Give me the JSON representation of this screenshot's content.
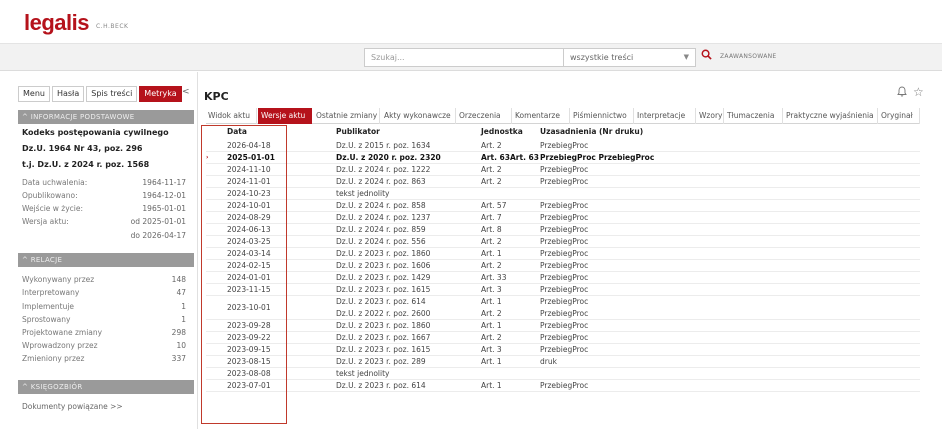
{
  "brand": {
    "logo": "legalis",
    "logo_sub": "C.H.BECK"
  },
  "search": {
    "placeholder": "Szukaj...",
    "scope": "wszystkie treści",
    "advanced": "ZAAWANSOWANE"
  },
  "sidebar": {
    "tabs": [
      "Menu",
      "Hasła",
      "Spis treści",
      "Metryka"
    ],
    "active_tab": "Metryka",
    "basic_info": {
      "heading": "INFORMACJE PODSTAWOWE",
      "title": "Kodeks postępowania cywilnego",
      "dzu": "Dz.U. 1964 Nr 43, poz. 296",
      "tj": "t.j. Dz.U. z 2024 r. poz. 1568",
      "fields": [
        {
          "label": "Data uchwalenia:",
          "value": "1964-11-17"
        },
        {
          "label": "Opublikowano:",
          "value": "1964-12-01"
        },
        {
          "label": "Wejście w życie:",
          "value": "1965-01-01"
        },
        {
          "label": "Wersja aktu:",
          "value": "od 2025-01-01"
        },
        {
          "label": "",
          "value": "do 2026-04-17"
        }
      ]
    },
    "relations": {
      "heading": "RELACJE",
      "items": [
        {
          "label": "Wykonywany przez",
          "value": "148"
        },
        {
          "label": "Interpretowany",
          "value": "47"
        },
        {
          "label": "Implementuje",
          "value": "1"
        },
        {
          "label": "Sprostowany",
          "value": "1"
        },
        {
          "label": "Projektowane zmiany",
          "value": "298"
        },
        {
          "label": "Wprowadzony przez",
          "value": "10"
        },
        {
          "label": "Zmieniony przez",
          "value": "337"
        }
      ]
    },
    "library": {
      "heading": "KSIĘGOZBIÓR",
      "link": "Dokumenty powiązane >>"
    }
  },
  "main": {
    "title": "KPC",
    "tabs": [
      "Widok aktu",
      "Wersje aktu",
      "Ostatnie zmiany",
      "Akty wykonawcze",
      "Orzeczenia",
      "Komentarze",
      "Piśmiennictwo",
      "Interpretacje",
      "Wzory",
      "Tłumaczenia",
      "Praktyczne wyjaśnienia",
      "Oryginał"
    ],
    "active_tab": "Wersje aktu",
    "columns": [
      "Data",
      "Publikator",
      "Jednostka",
      "Uzasadnienia (Nr druku)"
    ],
    "rows": [
      {
        "date": "2026-04-18",
        "pub": [
          "Dz.U. z 2015 r. poz. 1634"
        ],
        "unit": [
          "Art. 2"
        ],
        "just": [
          "PrzebiegProc"
        ]
      },
      {
        "date": "2025-01-01",
        "pub": [
          "Dz.U. z 2020 r. poz. 2320"
        ],
        "unit": [
          "Art. 63Art. 63"
        ],
        "just": [
          "PrzebiegProc PrzebiegProc"
        ],
        "current": true
      },
      {
        "date": "2024-11-10",
        "pub": [
          "Dz.U. z 2024 r. poz. 1222"
        ],
        "unit": [
          "Art. 2"
        ],
        "just": [
          "PrzebiegProc"
        ]
      },
      {
        "date": "2024-11-01",
        "pub": [
          "Dz.U. z 2024 r. poz. 863"
        ],
        "unit": [
          "Art. 2"
        ],
        "just": [
          "PrzebiegProc"
        ]
      },
      {
        "date": "2024-10-23",
        "pub": [
          "tekst jednolity"
        ],
        "unit": [
          ""
        ],
        "just": [
          ""
        ]
      },
      {
        "date": "2024-10-01",
        "pub": [
          "Dz.U. z 2024 r. poz. 858"
        ],
        "unit": [
          "Art. 57"
        ],
        "just": [
          "PrzebiegProc"
        ]
      },
      {
        "date": "2024-08-29",
        "pub": [
          "Dz.U. z 2024 r. poz. 1237"
        ],
        "unit": [
          "Art. 7"
        ],
        "just": [
          "PrzebiegProc"
        ]
      },
      {
        "date": "2024-06-13",
        "pub": [
          "Dz.U. z 2024 r. poz. 859"
        ],
        "unit": [
          "Art. 8"
        ],
        "just": [
          "PrzebiegProc"
        ]
      },
      {
        "date": "2024-03-25",
        "pub": [
          "Dz.U. z 2024 r. poz. 556"
        ],
        "unit": [
          "Art. 2"
        ],
        "just": [
          "PrzebiegProc"
        ]
      },
      {
        "date": "2024-03-14",
        "pub": [
          "Dz.U. z 2023 r. poz. 1860"
        ],
        "unit": [
          "Art. 1"
        ],
        "just": [
          "PrzebiegProc"
        ]
      },
      {
        "date": "2024-02-15",
        "pub": [
          "Dz.U. z 2023 r. poz. 1606"
        ],
        "unit": [
          "Art. 2"
        ],
        "just": [
          "PrzebiegProc"
        ]
      },
      {
        "date": "2024-01-01",
        "pub": [
          "Dz.U. z 2023 r. poz. 1429"
        ],
        "unit": [
          "Art. 33"
        ],
        "just": [
          "PrzebiegProc"
        ]
      },
      {
        "date": "2023-11-15",
        "pub": [
          "Dz.U. z 2023 r. poz. 1615"
        ],
        "unit": [
          "Art. 3"
        ],
        "just": [
          "PrzebiegProc"
        ]
      },
      {
        "date": "2023-10-01",
        "pub": [
          "Dz.U. z 2023 r. poz. 614",
          "Dz.U. z 2022 r. poz. 2600"
        ],
        "unit": [
          "Art. 1",
          "Art. 2"
        ],
        "just": [
          "PrzebiegProc",
          "PrzebiegProc"
        ]
      },
      {
        "date": "2023-09-28",
        "pub": [
          "Dz.U. z 2023 r. poz. 1860"
        ],
        "unit": [
          "Art. 1"
        ],
        "just": [
          "PrzebiegProc"
        ]
      },
      {
        "date": "2023-09-22",
        "pub": [
          "Dz.U. z 2023 r. poz. 1667"
        ],
        "unit": [
          "Art. 2"
        ],
        "just": [
          "PrzebiegProc"
        ]
      },
      {
        "date": "2023-09-15",
        "pub": [
          "Dz.U. z 2023 r. poz. 1615"
        ],
        "unit": [
          "Art. 3"
        ],
        "just": [
          "PrzebiegProc"
        ]
      },
      {
        "date": "2023-08-15",
        "pub": [
          "Dz.U. z 2023 r. poz. 289"
        ],
        "unit": [
          "Art. 1"
        ],
        "just": [
          "druk"
        ]
      },
      {
        "date": "2023-08-08",
        "pub": [
          "tekst jednolity"
        ],
        "unit": [
          ""
        ],
        "just": [
          ""
        ]
      },
      {
        "date": "2023-07-01",
        "pub": [
          "Dz.U. z 2023 r. poz. 614"
        ],
        "unit": [
          "Art. 1"
        ],
        "just": [
          "PrzebiegProc"
        ]
      }
    ]
  }
}
